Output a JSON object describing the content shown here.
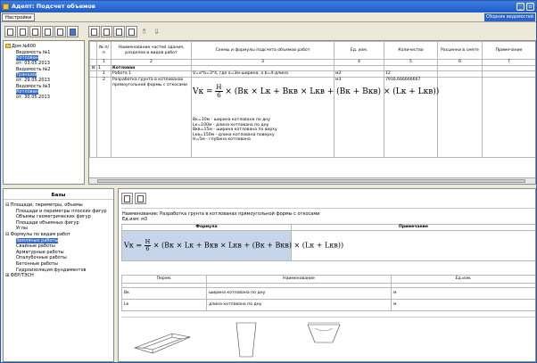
{
  "window": {
    "title": "Адепт: Подсчет объемов"
  },
  "menu": {
    "settings_label": "Настройки",
    "right_button": "Сборник ведомостей"
  },
  "left_tree": {
    "root": "Дом №600",
    "items": [
      {
        "title": "Ведомость №1",
        "obj": "Котлован",
        "date": "от: 03.05.2013"
      },
      {
        "title": "Ведомость №2",
        "obj": "Траншеи",
        "date": "от: 29.05.2013"
      },
      {
        "title": "Ведомость №3",
        "obj": "Котлован",
        "date": "от: 30.05.2013"
      }
    ]
  },
  "grid": {
    "headers": [
      "№ п/п",
      "Наименование частей здания, разделов и видов работ",
      "Схемы и формулы подсчета объемов работ",
      "Ед. изм.",
      "Количество",
      "Расценки в смете",
      "Примечание"
    ],
    "numbers": [
      "",
      "1",
      "2",
      "3",
      "4",
      "5",
      "6",
      "7"
    ],
    "section": {
      "num": "1",
      "name": "Котлован"
    },
    "rows": [
      {
        "num": "1",
        "name": "Работа 1",
        "formula_text": "V=a*b=3*4, где a=3м-ширина, a b=4-длина",
        "unit": "м2",
        "qty": "12"
      },
      {
        "num": "2",
        "name": "Разработка грунта в котлованах прямоугольной формы с откосами",
        "unit": "м3",
        "qty": "7916.666666667"
      }
    ],
    "formula": {
      "lhs": "Vк = ",
      "num": "H",
      "den": "6",
      "rhs": "× (Bк × Lк + Bкв × Lкв + (Bк + Bкв) × (Lк + Lкв))"
    },
    "params": [
      "Bк=10м - ширина котлована по дну",
      "Lк=100м - длина котлована по дну",
      "Bкв=15м - ширина котлована по верху",
      "Lкв=150м - длина котлована поверху",
      "H=5м - глубина котлована"
    ]
  },
  "bases": {
    "title": "Базы",
    "tree": [
      {
        "label": "Площади, периметры, объемы",
        "level": 0,
        "expander": "⊟"
      },
      {
        "label": "Площади и периметры плоских фигур",
        "level": 1
      },
      {
        "label": "Объемы геометрических фигур",
        "level": 1
      },
      {
        "label": "Площади объемных фигур",
        "level": 1
      },
      {
        "label": "Углы",
        "level": 1
      },
      {
        "label": "Формулы по видам работ",
        "level": 0,
        "expander": "⊟"
      },
      {
        "label": "Земляные работы",
        "level": 1,
        "selected": true
      },
      {
        "label": "Свайные работы",
        "level": 1
      },
      {
        "label": "Арматурные работы",
        "level": 1
      },
      {
        "label": "Опалубочные работы",
        "level": 1
      },
      {
        "label": "Бетонные работы",
        "level": 1
      },
      {
        "label": "Гидроизоляция фундаментов",
        "level": 1
      },
      {
        "label": "ФЕР/ТЭСН",
        "level": 0,
        "expander": "⊞"
      }
    ]
  },
  "detail": {
    "name_line": "Наименование: Разработка грунта в котлованах прямоугольной формы с откосами",
    "unit_line": "Ед.изм: м3",
    "formula_header": "Формула",
    "note_header": "Примечание",
    "param_headers": [
      "Перем.",
      "Наименование",
      "Ед.изм."
    ],
    "params": [
      {
        "var": "Bк",
        "name": "ширина котлована по дну",
        "unit": "м"
      },
      {
        "var": "Lк",
        "name": "длина котлована по дну",
        "unit": "м"
      }
    ]
  }
}
